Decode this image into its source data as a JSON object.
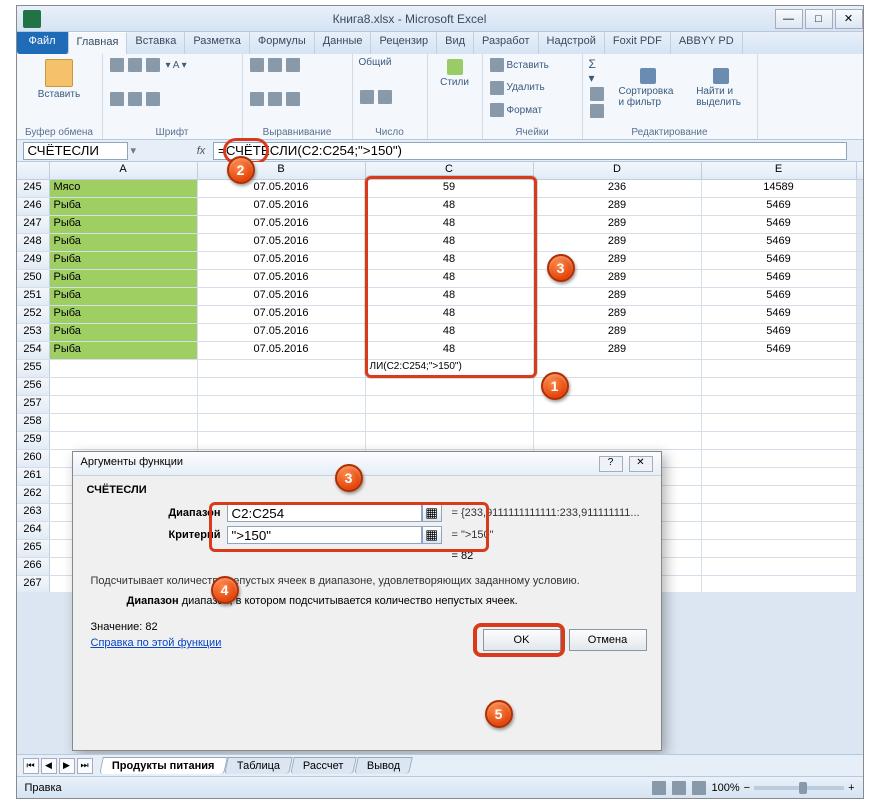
{
  "window": {
    "title": "Книга8.xlsx - Microsoft Excel"
  },
  "tabs": {
    "file": "Файл",
    "home": "Главная",
    "insert": "Вставка",
    "layout": "Разметка",
    "formulas": "Формулы",
    "data": "Данные",
    "review": "Рецензир",
    "view": "Вид",
    "dev": "Разработ",
    "addins": "Надстрой",
    "foxit": "Foxit PDF",
    "abbyy": "ABBYY PD"
  },
  "ribbon": {
    "paste": "Вставить",
    "clipboard": "Буфер обмена",
    "font": "Шрифт",
    "align": "Выравнивание",
    "number": "Число",
    "styles": "Стили",
    "cells": "Ячейки",
    "edit": "Редактирование",
    "general": "Общий",
    "insert_c": "Вставить",
    "delete_c": "Удалить",
    "format_c": "Формат",
    "sort": "Сортировка и фильтр",
    "find": "Найти и выделить"
  },
  "formula": {
    "namebox": "СЧЁТЕСЛИ",
    "fx": "fx",
    "value": "=СЧЁТЕСЛИ(C2:C254;\">150\")"
  },
  "cols": [
    "A",
    "B",
    "C",
    "D",
    "E"
  ],
  "rows": [
    {
      "n": 245,
      "a": "Мясо",
      "b": "07.05.2016",
      "c": "59",
      "d": "236",
      "e": "14589"
    },
    {
      "n": 246,
      "a": "Рыба",
      "b": "07.05.2016",
      "c": "48",
      "d": "289",
      "e": "5469"
    },
    {
      "n": 247,
      "a": "Рыба",
      "b": "07.05.2016",
      "c": "48",
      "d": "289",
      "e": "5469"
    },
    {
      "n": 248,
      "a": "Рыба",
      "b": "07.05.2016",
      "c": "48",
      "d": "289",
      "e": "5469"
    },
    {
      "n": 249,
      "a": "Рыба",
      "b": "07.05.2016",
      "c": "48",
      "d": "289",
      "e": "5469"
    },
    {
      "n": 250,
      "a": "Рыба",
      "b": "07.05.2016",
      "c": "48",
      "d": "289",
      "e": "5469"
    },
    {
      "n": 251,
      "a": "Рыба",
      "b": "07.05.2016",
      "c": "48",
      "d": "289",
      "e": "5469"
    },
    {
      "n": 252,
      "a": "Рыба",
      "b": "07.05.2016",
      "c": "48",
      "d": "289",
      "e": "5469"
    },
    {
      "n": 253,
      "a": "Рыба",
      "b": "07.05.2016",
      "c": "48",
      "d": "289",
      "e": "5469"
    },
    {
      "n": 254,
      "a": "Рыба",
      "b": "07.05.2016",
      "c": "48",
      "d": "289",
      "e": "5469"
    }
  ],
  "formula_cell": "ЛИ(C2:C254;\">150\")",
  "dialog": {
    "title": "Аргументы функции",
    "func": "СЧЁТЕСЛИ",
    "arg1_label": "Диапазон",
    "arg1_val": "C2:C254",
    "arg1_res": "= {233,9111111111111:233,911111111...",
    "arg2_label": "Критерий",
    "arg2_val": "\">150\"",
    "arg2_res": "= \">150\"",
    "calc": "= 82",
    "desc": "Подсчитывает количество непустых ячеек в диапазоне, удовлетворяющих заданному условию.",
    "desc2_b": "Диапазон",
    "desc2": " диапазон, в котором подсчитывается количество непустых ячеек.",
    "value_label": "Значение:",
    "value": "82",
    "help": "Справка по этой функции",
    "ok": "OK",
    "cancel": "Отмена"
  },
  "sheets": {
    "s1": "Продукты питания",
    "s2": "Таблица",
    "s3": "Рассчет",
    "s4": "Вывод"
  },
  "status": {
    "mode": "Правка",
    "zoom": "100%",
    "minus": "−",
    "plus": "+"
  },
  "markers": {
    "m1": "1",
    "m2": "2",
    "m3": "3",
    "m3b": "3",
    "m4": "4",
    "m5": "5"
  }
}
